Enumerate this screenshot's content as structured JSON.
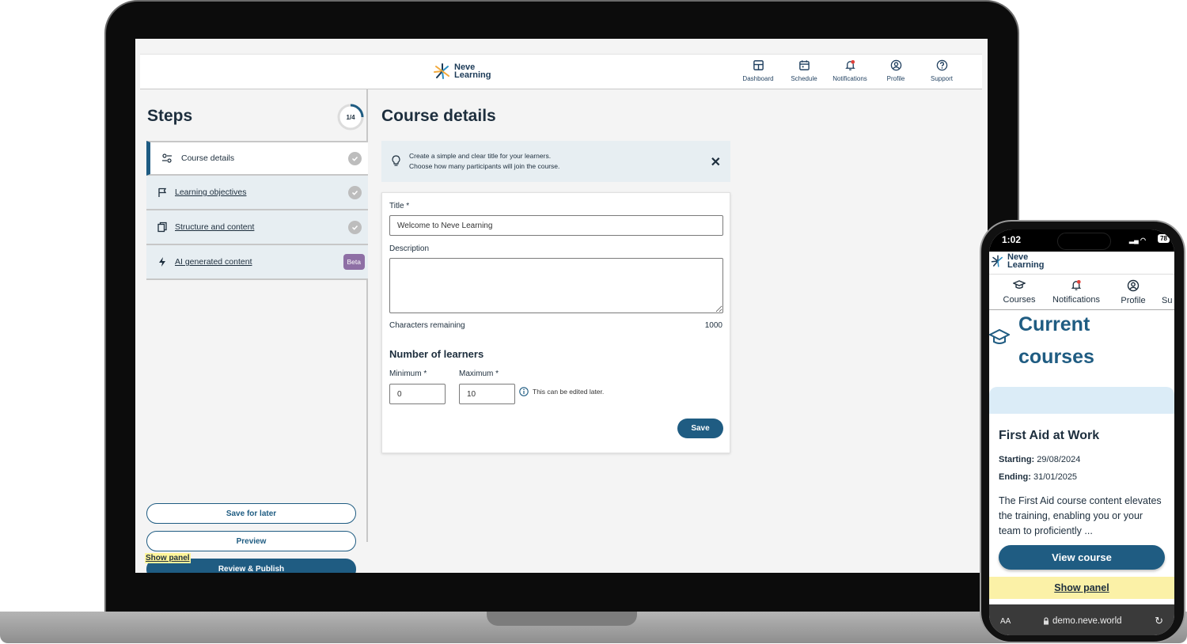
{
  "colors": {
    "primary": "#1f5c82",
    "heading": "#1d2e3d",
    "info_bg": "#e7eef2",
    "highlight": "#fff59a",
    "beta": "#8e6fa5",
    "notification_dot": "#e0413a"
  },
  "laptop": {
    "brand": {
      "line1": "Neve",
      "line2": "Learning"
    },
    "nav": [
      {
        "label": "Dashboard",
        "icon": "dashboard-icon"
      },
      {
        "label": "Schedule",
        "icon": "calendar-icon"
      },
      {
        "label": "Notifications",
        "icon": "bell-icon"
      },
      {
        "label": "Profile",
        "icon": "profile-icon"
      },
      {
        "label": "Support",
        "icon": "help-icon"
      }
    ],
    "sidebar": {
      "title": "Steps",
      "progress_text": "1/4",
      "progress_fraction": 0.25,
      "steps": [
        {
          "label": "Course details",
          "icon": "settings-sliders-icon",
          "status": "check",
          "active": true
        },
        {
          "label": "Learning objectives",
          "icon": "flag-icon",
          "status": "check"
        },
        {
          "label": "Structure and content",
          "icon": "copy-icon",
          "status": "check"
        },
        {
          "label": "AI generated content",
          "icon": "lightning-icon",
          "badge": "Beta"
        }
      ],
      "save_for_later": "Save for later",
      "preview": "Preview",
      "review_publish": "Review & Publish",
      "show_panel": "Show panel"
    },
    "main": {
      "title": "Course details",
      "info": {
        "line1": "Create a simple and clear title for your learners.",
        "line2": "Choose how many participants will join the course.",
        "close": "✕"
      },
      "form": {
        "title_label": "Title *",
        "title_value": "Welcome to Neve Learning",
        "description_label": "Description",
        "description_value": "",
        "chars_label": "Characters remaining",
        "chars_value": "1000",
        "learners_title": "Number of learners",
        "min_label": "Minimum *",
        "min_value": "0",
        "max_label": "Maximum *",
        "max_value": "10",
        "hint": "This can be edited later.",
        "save": "Save"
      }
    }
  },
  "phone": {
    "time": "1:02",
    "battery": "78",
    "brand": {
      "line1": "Neve",
      "line2": "Learning"
    },
    "nav": [
      {
        "label": "Courses",
        "icon": "graduation-cap-icon"
      },
      {
        "label": "Notifications",
        "icon": "bell-icon"
      },
      {
        "label": "Profile",
        "icon": "profile-icon"
      },
      {
        "label": "Su",
        "icon": ""
      }
    ],
    "heading": "Current courses",
    "course": {
      "title": "First Aid at Work",
      "starting_label": "Starting:",
      "starting_value": "29/08/2024",
      "ending_label": "Ending:",
      "ending_value": "31/01/2025",
      "description": "The  First Aid course content elevates the training, enabling you or your team to proficiently ...",
      "button": "View course"
    },
    "show_panel": "Show panel",
    "url_bar": {
      "aa": "AA",
      "url": "demo.neve.world",
      "reload": "↻"
    }
  }
}
